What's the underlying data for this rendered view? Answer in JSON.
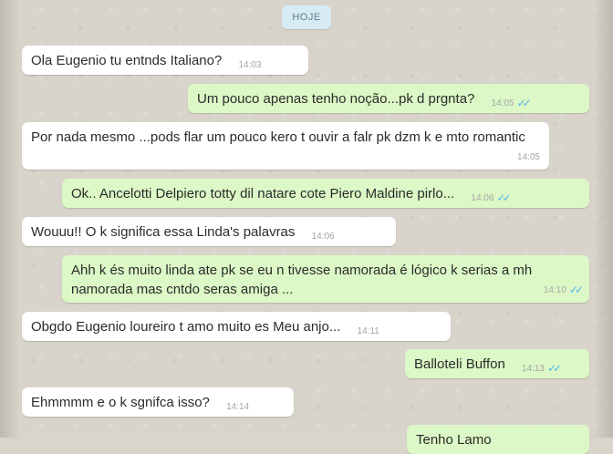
{
  "date_chip": "HOJE",
  "messages": [
    {
      "text": "Ola Eugenio tu entnds Italiano?",
      "time": "14:03"
    },
    {
      "text": "Um pouco apenas tenho noção...pk d prgnta?",
      "time": "14:05"
    },
    {
      "text": "Por nada mesmo ...pods flar um pouco kero t ouvir a falr pk dzm k e mto romantic",
      "time": "14:05"
    },
    {
      "text": "Ok.. Ancelotti Delpiero totty dil natare cote Piero Maldine pirlo...",
      "time": "14:06"
    },
    {
      "text": "Wouuu!! O k significa essa Linda's palavras",
      "time": "14:06"
    },
    {
      "text": "Ahh k és muito linda ate pk se eu n tivesse namorada é lógico k serias a mh namorada mas cntdo seras amiga ...",
      "time": "14:10"
    },
    {
      "text": "Obgdo Eugenio loureiro  t amo muito es Meu anjo...",
      "time": "14:11"
    },
    {
      "text": "Balloteli Buffon",
      "time": "14:13"
    },
    {
      "text": "Ehmmmm e o k sgnifca isso?",
      "time": "14:14"
    },
    {
      "text": "Tenho Lamo",
      "time": ""
    }
  ],
  "icons": {
    "read_receipt": "double-check-icon"
  },
  "colors": {
    "incoming": "#ffffff",
    "outgoing": "#dcf8c6",
    "read_ticks": "#4fb6ec"
  }
}
